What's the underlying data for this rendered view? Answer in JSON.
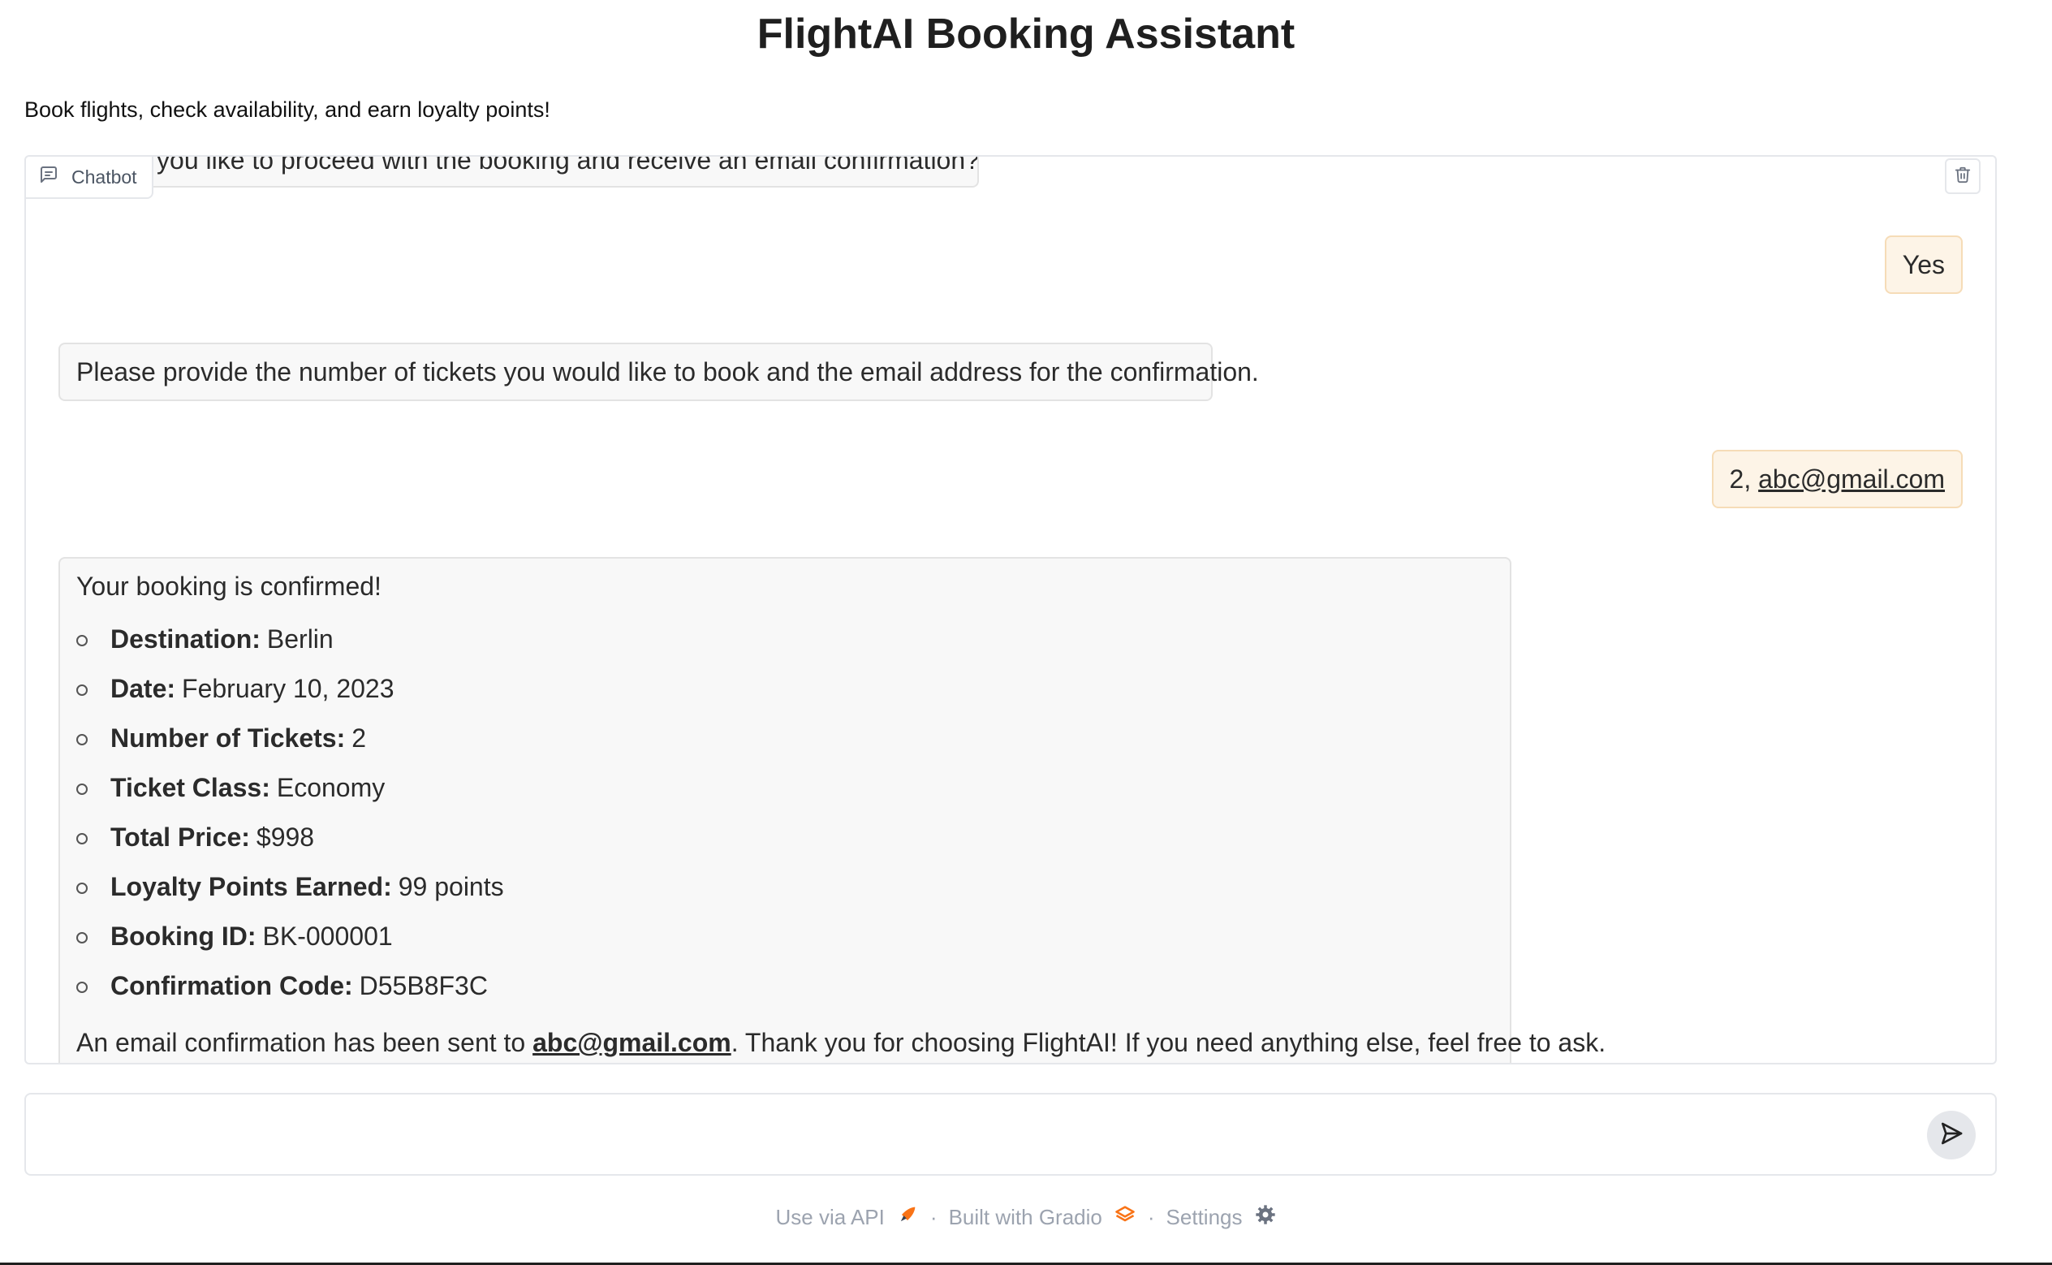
{
  "header": {
    "title": "FlightAI Booking Assistant",
    "subtitle": "Book flights, check availability, and earn loyalty points!"
  },
  "chatbot": {
    "label": "Chatbot",
    "messages": {
      "partial_bot": "Would you like to proceed with the booking and receive an email confirmation?",
      "user_yes": "Yes",
      "bot_ask": "Please provide the number of tickets you would like to book and the email address for the confirmation.",
      "user_reply_prefix": "2, ",
      "user_reply_email": "abc@gmail.com",
      "confirmation": {
        "heading": "Your booking is confirmed!",
        "items": [
          {
            "label": "Destination:",
            "value": "Berlin"
          },
          {
            "label": "Date:",
            "value": "February 10, 2023"
          },
          {
            "label": "Number of Tickets:",
            "value": "2"
          },
          {
            "label": "Ticket Class:",
            "value": "Economy"
          },
          {
            "label": "Total Price:",
            "value": "$998"
          },
          {
            "label": "Loyalty Points Earned:",
            "value": "99 points"
          },
          {
            "label": "Booking ID:",
            "value": "BK-000001"
          },
          {
            "label": "Confirmation Code:",
            "value": "D55B8F3C"
          }
        ],
        "footer_before": "An email confirmation has been sent to ",
        "footer_email": "abc@gmail.com",
        "footer_after": ". Thank you for choosing FlightAI! If you need anything else, feel free to ask."
      }
    }
  },
  "input": {
    "placeholder": "",
    "value": ""
  },
  "footer": {
    "api": "Use via API",
    "built": "Built with Gradio",
    "settings": "Settings",
    "separator": "·"
  },
  "colors": {
    "user_bubble": "#fdf4e7",
    "bot_bubble": "#f8f8f8",
    "gradio_orange": "#f97316"
  }
}
